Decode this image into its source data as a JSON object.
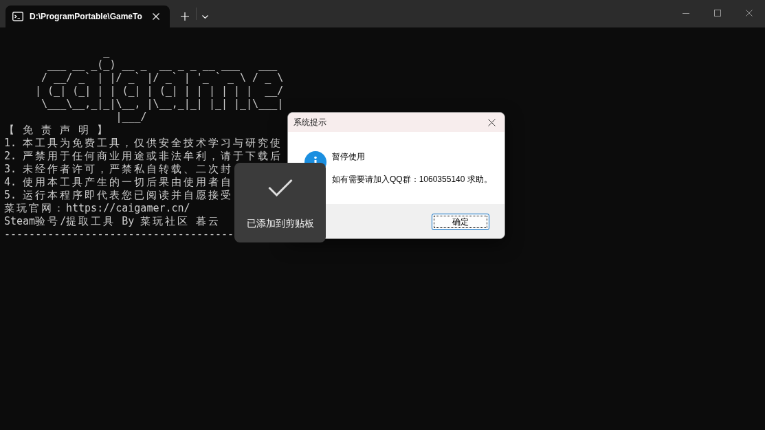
{
  "window": {
    "tabs": [
      {
        "title": "D:\\ProgramPortable\\GameTo",
        "selected": true
      }
    ]
  },
  "terminal": {
    "banner": [
      "            _",
      "   ___ __ _(_) __ _  __ _ _ __ ___   ___",
      "  / __/ _` | |/ _` |/ _` | '_ ` _ \\ / _ \\",
      " | (_| (_| | | (_| | (_| | | | | | |  __/",
      "  \\___\\__,_|_|\\__, |\\__,_|_| |_| |_|\\___|",
      "              |___/"
    ],
    "lines": [
      "【 免 责 声 明 】",
      "1. 本工具为免费工具，仅供安全技术学习与研究使",
      "2. 严禁用于任何商业用途或非法牟利，请于下载后",
      "3. 未经作者许可，严禁私自转载、二次封",
      "4. 使用本工具产生的一切后果由使用者自",
      "5. 运行本程序即代表您已阅读并自愿接受",
      "菜玩官网：https://caigamer.cn/",
      "Steam验号/提取工具 By 菜玩社区 暮云",
      "-------------------------------------"
    ]
  },
  "dialog": {
    "title": "系统提示",
    "heading": "暂停使用",
    "message": "如有需要请加入QQ群：1060355140 求助。",
    "buttons": [
      {
        "label": "确定",
        "focused": true
      }
    ]
  },
  "toast": {
    "message": "已添加到剪贴板"
  }
}
